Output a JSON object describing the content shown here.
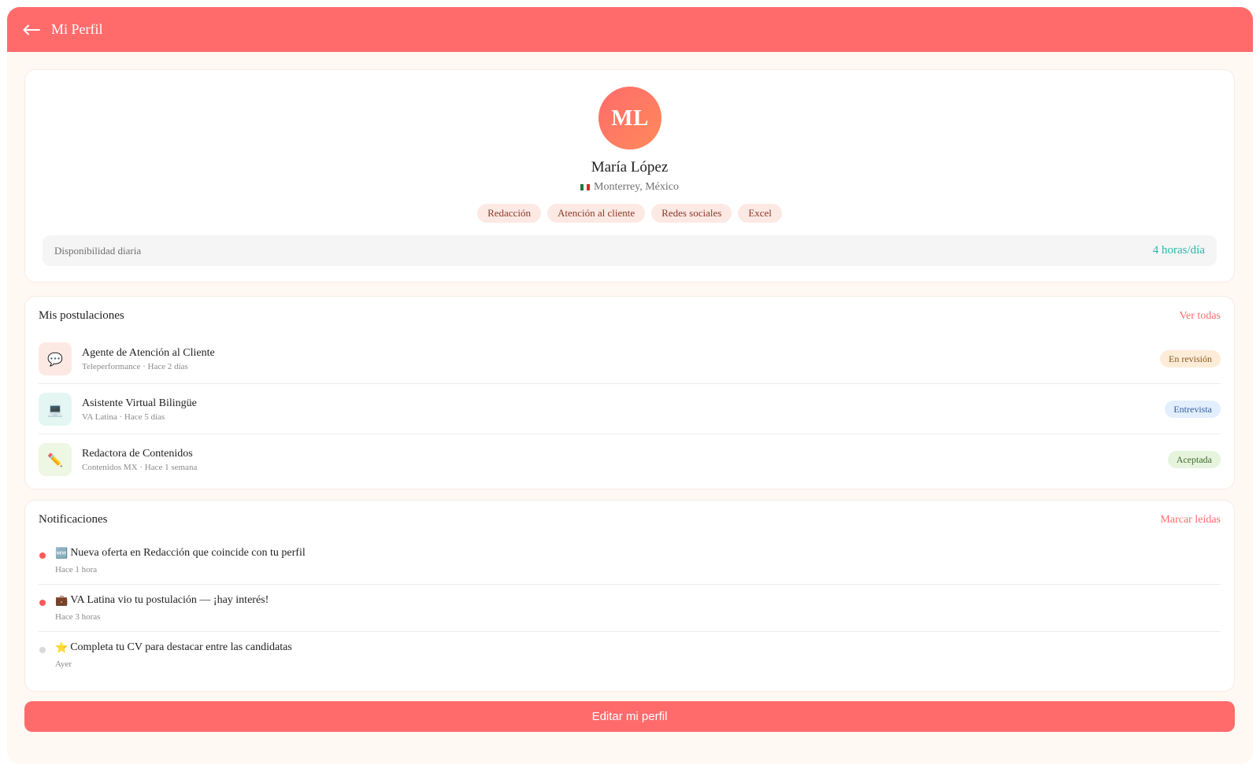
{
  "header": {
    "title": "Mi Perfil",
    "back_icon": "arrow-left-icon"
  },
  "profile": {
    "initials": "ML",
    "name": "María López",
    "location": "Monterrey, México",
    "flag_icon": "mexico-flag-icon",
    "skills": [
      "Redacción",
      "Atención al cliente",
      "Redes sociales",
      "Excel"
    ],
    "availability_label": "Disponibilidad diaria",
    "availability_value": "4 horas/día"
  },
  "applications": {
    "title": "Mis postulaciones",
    "link": "Ver todas",
    "items": [
      {
        "title": "Agente de Atención al Cliente",
        "meta": "Teleperformance · Hace 2 días",
        "icon": "speech-bubble-icon",
        "glyph": "💬",
        "icon_bg": "#fde9e4",
        "status": "En revisión",
        "status_bg": "#fdecd8",
        "status_color": "#8a5a1e"
      },
      {
        "title": "Asistente Virtual Bilingüe",
        "meta": "VA Latina · Hace 5 días",
        "icon": "laptop-icon",
        "glyph": "💻",
        "icon_bg": "#e3f6f1",
        "status": "Entrevista",
        "status_bg": "#e3efff",
        "status_color": "#2f5ea0"
      },
      {
        "title": "Redactora de Contenidos",
        "meta": "Contenidos MX · Hace 1 semana",
        "icon": "pencil-icon",
        "glyph": "✏️",
        "icon_bg": "#eef6e4",
        "status": "Aceptada",
        "status_bg": "#e6f4de",
        "status_color": "#3d6a2a"
      }
    ]
  },
  "notifications": {
    "title": "Notificaciones",
    "link": "Marcar leídas",
    "items": [
      {
        "icon": "new-badge-icon",
        "glyph": "🆕",
        "text": "Nueva oferta en Redacción que coincide con tu perfil",
        "time": "Hace 1 hora",
        "unread": true
      },
      {
        "icon": "briefcase-icon",
        "glyph": "💼",
        "text": "VA Latina vio tu postulación — ¡hay interés!",
        "time": "Hace 3 horas",
        "unread": true
      },
      {
        "icon": "star-icon",
        "glyph": "⭐",
        "text": "Completa tu CV para destacar entre las candidatas",
        "time": "Ayer",
        "unread": false
      }
    ]
  },
  "edit_button_label": "Editar mi perfil",
  "colors": {
    "accent": "#ff6b6b",
    "teal": "#2ab7a9",
    "unread_dot": "#ff5a5a",
    "read_dot": "#d9d9d9"
  }
}
